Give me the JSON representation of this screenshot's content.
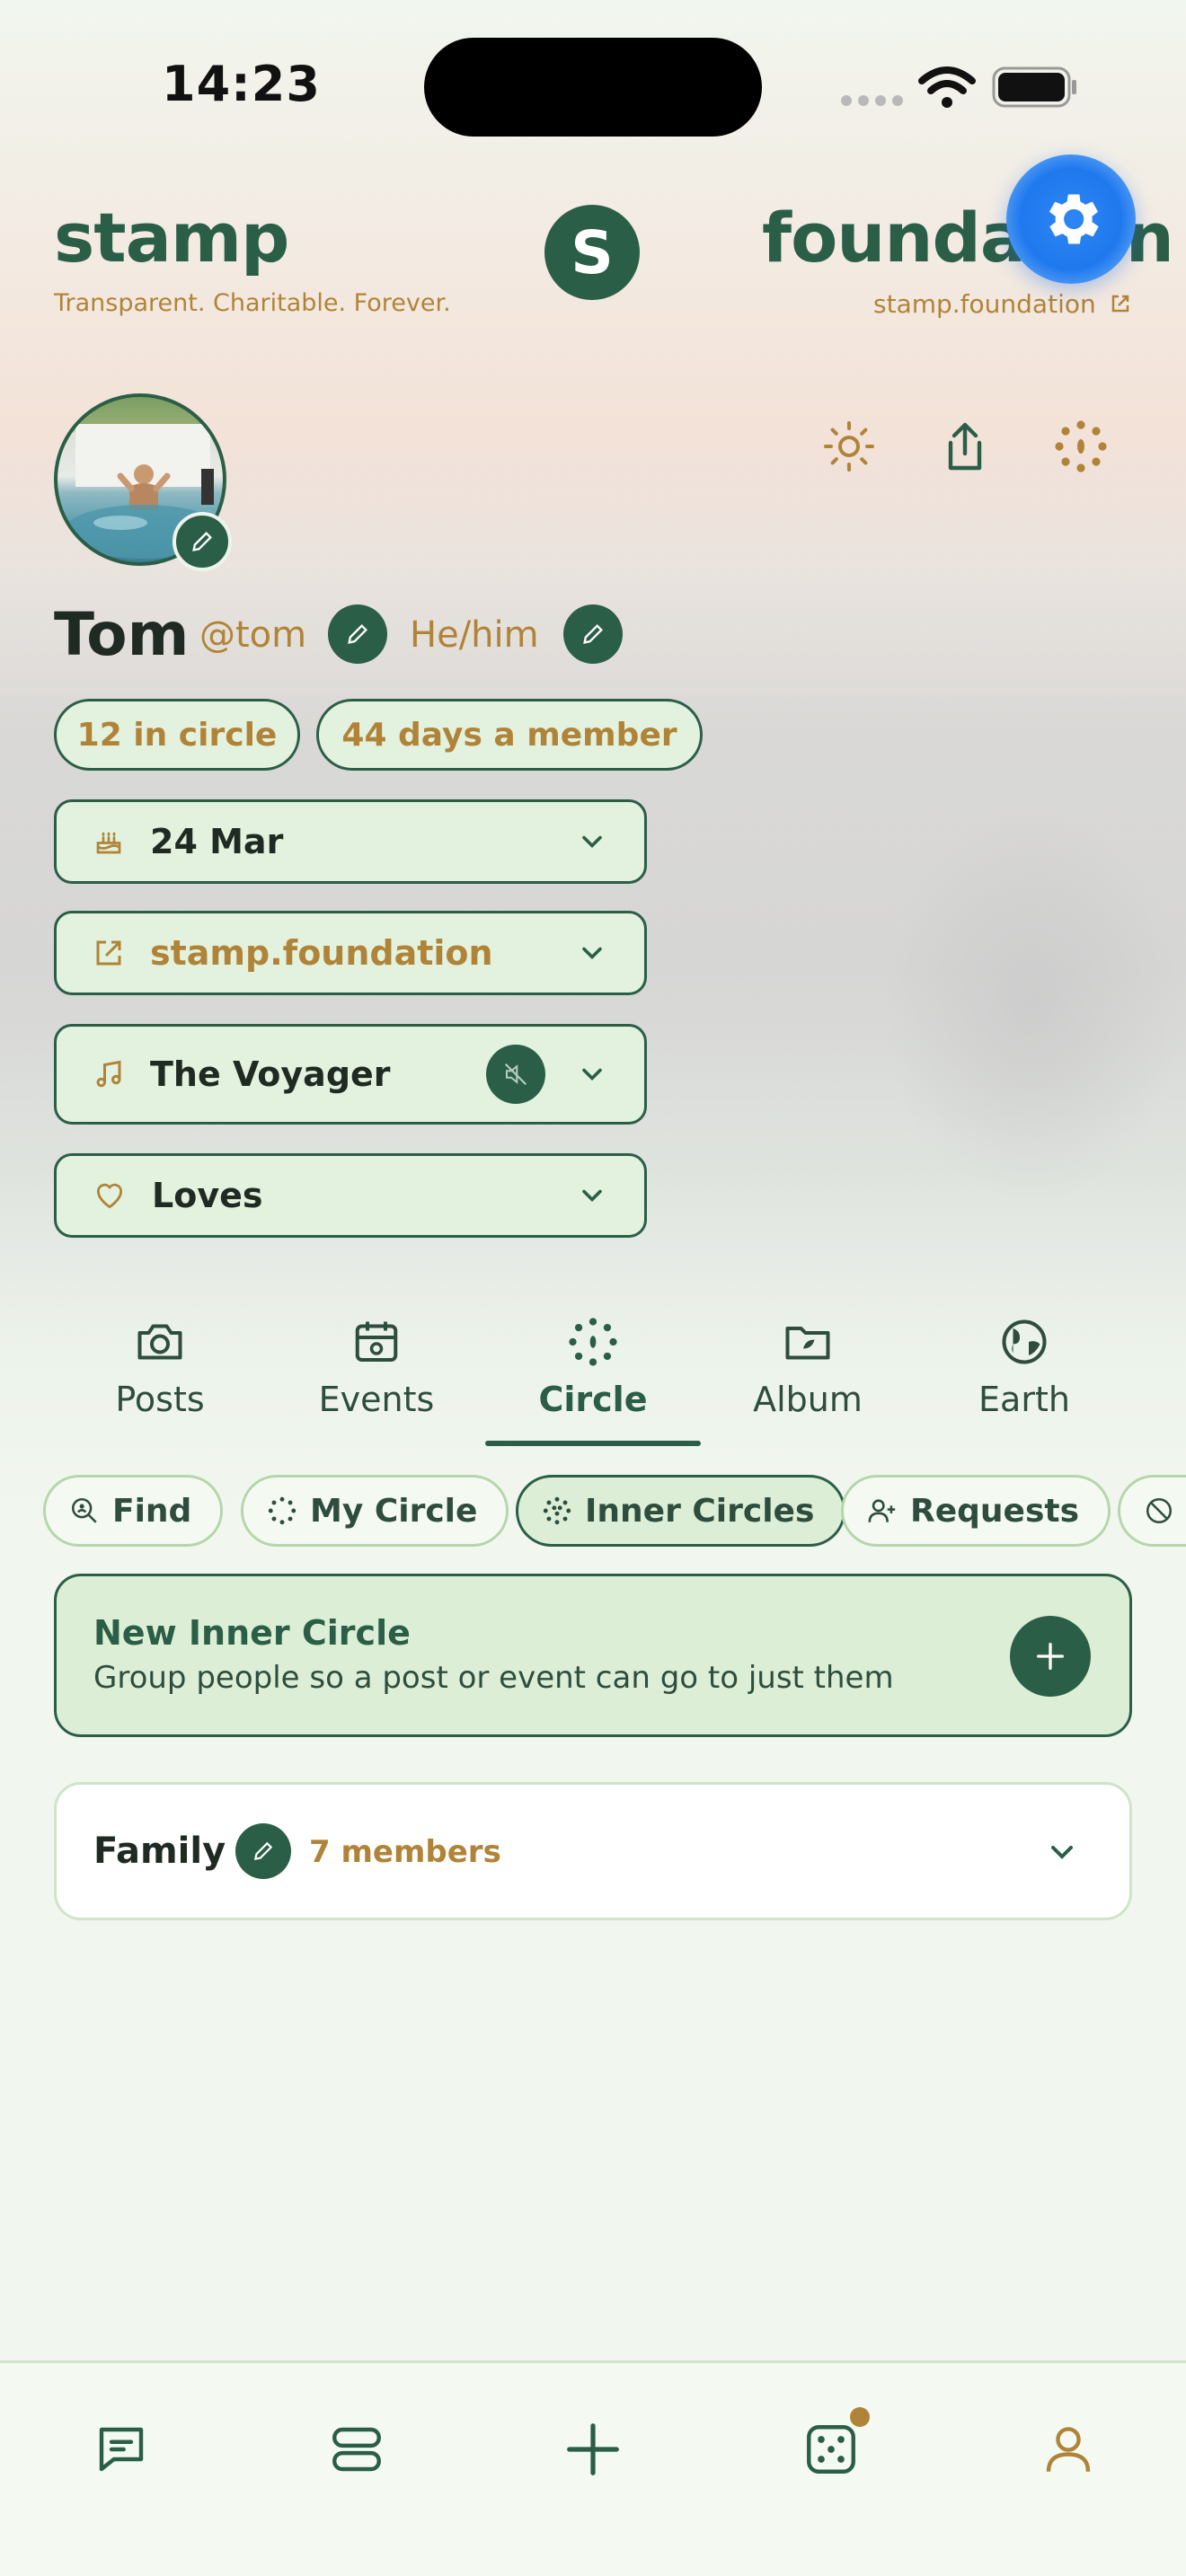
{
  "status_bar": {
    "time": "14:23"
  },
  "header": {
    "brand_left": "stamp",
    "tagline": "Transparent. Charitable. Forever.",
    "logo_letter": "S",
    "brand_right": "foundation",
    "url": "stamp.foundation"
  },
  "profile": {
    "name": "Tom",
    "handle": "@tom",
    "pronouns": "He/him",
    "circle_count": "12 in circle",
    "member_days": "44 days a member",
    "birthday": "24 Mar",
    "website": "stamp.foundation",
    "song": "The Voyager",
    "loves": "Loves"
  },
  "tabs": [
    {
      "label": "Posts",
      "icon": "camera-icon"
    },
    {
      "label": "Events",
      "icon": "calendar-icon"
    },
    {
      "label": "Circle",
      "icon": "dots-circle-icon",
      "active": true
    },
    {
      "label": "Album",
      "icon": "folder-icon"
    },
    {
      "label": "Earth",
      "icon": "globe-icon"
    }
  ],
  "chips": [
    {
      "label": "Find",
      "icon": "search-person-icon"
    },
    {
      "label": "My Circle",
      "icon": "dots-circle-icon"
    },
    {
      "label": "Inner Circles",
      "icon": "inner-dots-icon",
      "active": true
    },
    {
      "label": "Requests",
      "icon": "add-person-icon"
    },
    {
      "label": "",
      "icon": "blocked-icon"
    }
  ],
  "new_circle": {
    "title": "New Inner Circle",
    "subtitle": "Group people so a post or event can go to just them"
  },
  "circles": [
    {
      "name": "Family",
      "members": "7 members"
    }
  ],
  "bottom_nav": [
    {
      "icon": "chat-icon"
    },
    {
      "icon": "feed-icon"
    },
    {
      "icon": "plus-icon"
    },
    {
      "icon": "dice-icon",
      "badge": true
    },
    {
      "icon": "profile-icon"
    }
  ],
  "colors": {
    "primary": "#2b5e47",
    "gold": "#b08438",
    "mint": "#e3f2de",
    "fab_blue": "#1f79ee"
  }
}
